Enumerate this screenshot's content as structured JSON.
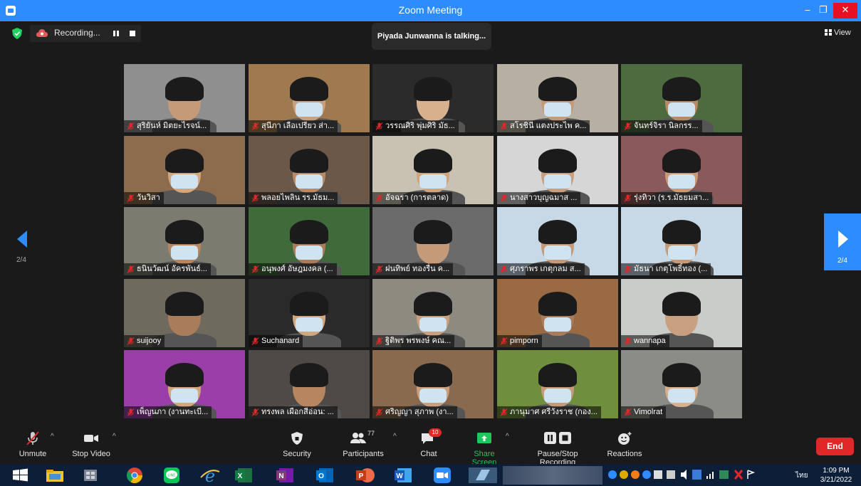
{
  "window": {
    "title": "Zoom Meeting",
    "min": "–",
    "max": "❐",
    "close": "✕"
  },
  "topbar": {
    "recording_label": "Recording...",
    "talking": "Piyada Junwanna is talking...",
    "view_label": "View"
  },
  "nav": {
    "left_page": "2/4",
    "right_page": "2/4"
  },
  "participants": [
    {
      "name": "สุริยันห์ มิตยะไรจน์...",
      "bg": "#8f8f8f",
      "face": "#c49a78",
      "mask": false
    },
    {
      "name": "สุนีภา เลือเปรียว ส่า...",
      "bg": "#a07a4f",
      "face": "#c9a07f",
      "mask": true
    },
    {
      "name": "วรรณศิริ พุ่มศิริ มัธ...",
      "bg": "#2b2b2b",
      "face": "#d7b08e",
      "mask": false
    },
    {
      "name": "สโรชินี แตงประไพ ค...",
      "bg": "#b7b0a2",
      "face": "#c49a78",
      "mask": true
    },
    {
      "name": "จันทร์จิรา นิลกรร...",
      "bg": "#4e6b3f",
      "face": "#b98a66",
      "mask": true
    },
    {
      "name": "วันวิสา",
      "bg": "#8d6c4d",
      "face": "#d2a67f",
      "mask": true
    },
    {
      "name": "พลอยไพลิน รร.มัธม...",
      "bg": "#6b5848",
      "face": "#b88a68",
      "mask": true
    },
    {
      "name": "อัจฉรา (การตลาด)",
      "bg": "#c9c2b3",
      "face": "#cfa57f",
      "mask": true
    },
    {
      "name": "นางสาวบุญฉมาส ...",
      "bg": "#d6d6d6",
      "face": "#c9a07f",
      "mask": true
    },
    {
      "name": "รุ่งทิวา (ร.ร.มัธยมสา...",
      "bg": "#8a5a5a",
      "face": "#c99a78",
      "mask": true
    },
    {
      "name": "ธนินวัฒน์ อัครพันธ์...",
      "bg": "#7b7b70",
      "face": "#b5865f",
      "mask": true
    },
    {
      "name": "อนุพงศ์ อัษฎมงคล (...",
      "bg": "#3f6a3a",
      "face": "#a97c5c",
      "mask": true
    },
    {
      "name": "ฝนทิพย์ ทองรื่น ค...",
      "bg": "#6b6b6b",
      "face": "#c49a78",
      "mask": false
    },
    {
      "name": "ศุภราพร เกตุกลม ส...",
      "bg": "#c7d8e6",
      "face": "#c49a78",
      "mask": true
    },
    {
      "name": "มัธนา เกตุโพธิ์ทอง (...",
      "bg": "#c7d8e6",
      "face": "#c49a78",
      "mask": true
    },
    {
      "name": "suijooy",
      "bg": "#6e6a5e",
      "face": "#a97c5c",
      "mask": false
    },
    {
      "name": "Suchanard",
      "bg": "#2a2a2a",
      "face": "#d2a67f",
      "mask": true
    },
    {
      "name": "ฐิติพร พรพงษ์ คณ...",
      "bg": "#8d8a80",
      "face": "#c9a07f",
      "mask": true
    },
    {
      "name": "pimporn",
      "bg": "#9a6a42",
      "face": "#a97c5c",
      "mask": true
    },
    {
      "name": "wannapa",
      "bg": "#c9ccc8",
      "face": "#c9a07f",
      "mask": false
    },
    {
      "name": "เพ็ญนภา (งานทะเบี...",
      "bg": "#9b3fa8",
      "face": "#d2a67f",
      "mask": true
    },
    {
      "name": "ทรงพล เผือกสีอ่อน: ...",
      "bg": "#4f4a45",
      "face": "#b5865f",
      "mask": false
    },
    {
      "name": "ศริญญา สุภาพ (งา...",
      "bg": "#8a6a4f",
      "face": "#c9a07f",
      "mask": true
    },
    {
      "name": "ภานุมาศ ศรีวังราช (กอง...",
      "bg": "#6f8f3f",
      "face": "#c49a78",
      "mask": true
    },
    {
      "name": "Vimolrat",
      "bg": "#8c8c86",
      "face": "#d7b08e",
      "mask": true
    }
  ],
  "toolbar": {
    "unmute": "Unmute",
    "stop_video": "Stop Video",
    "security": "Security",
    "participants": "Participants",
    "participants_count": "77",
    "chat": "Chat",
    "chat_badge": "10",
    "share_screen": "Share Screen",
    "pause_stop": "Pause/Stop Recording",
    "reactions": "Reactions",
    "end": "End"
  },
  "taskbar": {
    "lang": "ไทย",
    "time": "1:09 PM",
    "date": "3/21/2022",
    "apps": [
      "windows-start",
      "file-explorer",
      "app-grid",
      "chrome",
      "line",
      "internet-explorer",
      "excel",
      "onenote",
      "outlook",
      "powerpoint",
      "word",
      "zoom",
      "window-preview"
    ]
  },
  "colors": {
    "zoom_blue": "#2d8cff",
    "end_red": "#e02828",
    "share_green": "#21c55d"
  }
}
